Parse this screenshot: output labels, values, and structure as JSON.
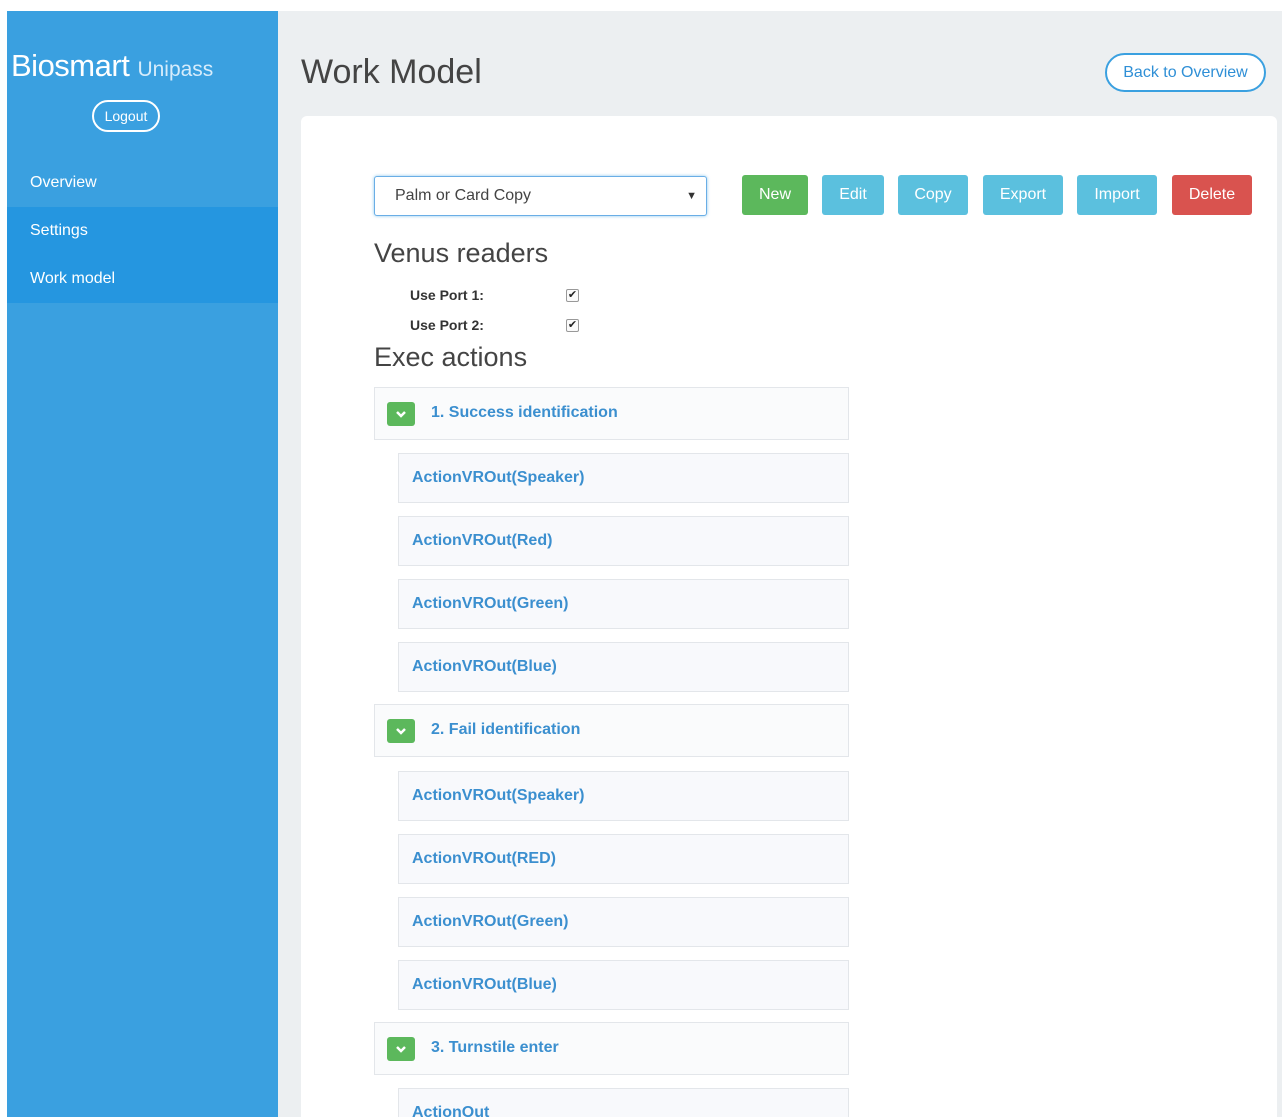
{
  "sidebar": {
    "brand": "Biosmart",
    "brand_sub": "Unipass",
    "logout": "Logout",
    "items": [
      {
        "label": "Overview"
      },
      {
        "label": "Settings"
      },
      {
        "label": "Work model"
      }
    ]
  },
  "header": {
    "title": "Work Model",
    "back": "Back to Overview"
  },
  "model_select": {
    "value": "Palm or Card Copy"
  },
  "toolbar": {
    "new": "New",
    "edit": "Edit",
    "copy": "Copy",
    "export": "Export",
    "import": "Import",
    "delete": "Delete"
  },
  "venus": {
    "title": "Venus readers",
    "ports": [
      {
        "label": "Use Port 1:",
        "checked": true
      },
      {
        "label": "Use Port 2:",
        "checked": true
      }
    ]
  },
  "exec": {
    "title": "Exec actions",
    "groups": [
      {
        "label": "1. Success identification",
        "actions": [
          "ActionVROut(Speaker)",
          "ActionVROut(Red)",
          "ActionVROut(Green)",
          "ActionVROut(Blue)"
        ]
      },
      {
        "label": "2. Fail identification",
        "actions": [
          "ActionVROut(Speaker)",
          "ActionVROut(RED)",
          "ActionVROut(Green)",
          "ActionVROut(Blue)"
        ]
      },
      {
        "label": "3. Turnstile enter",
        "actions": [
          "ActionOut"
        ]
      }
    ]
  },
  "colors": {
    "sidebar": "#3aa0e0",
    "nav_active": "#2596e0",
    "success": "#5cb85c",
    "info": "#5bc0de",
    "danger": "#d9534f",
    "link": "#3b8fcf"
  },
  "icons": {
    "toggle": "chevron-down-icon",
    "select_arrow": "caret-down-icon",
    "checkbox": "checkmark-icon"
  }
}
